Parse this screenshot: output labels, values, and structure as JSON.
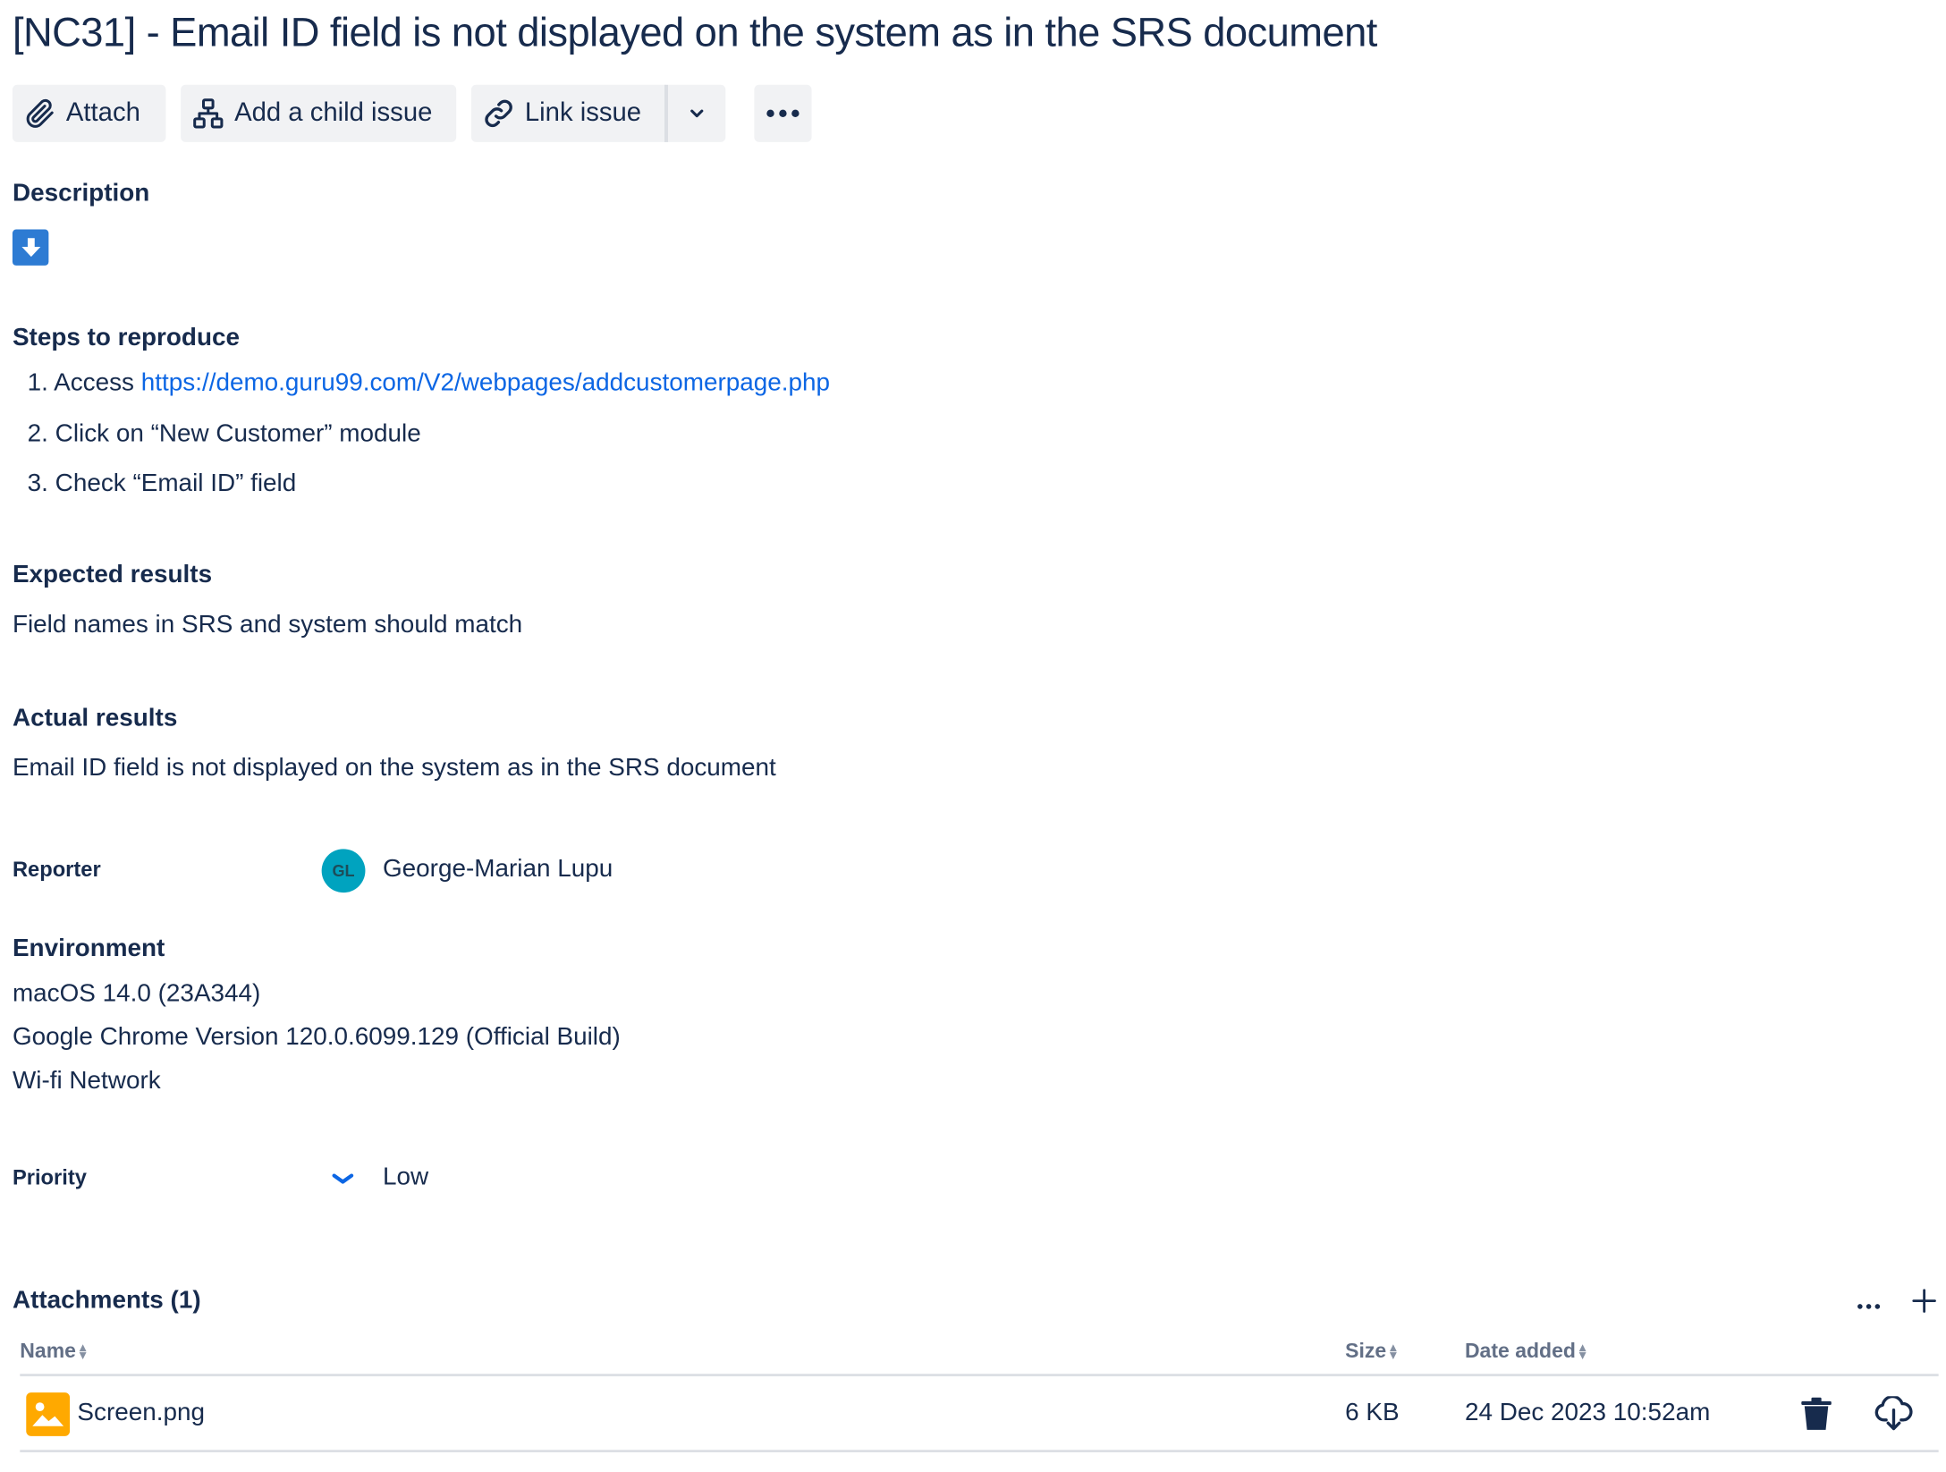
{
  "issue": {
    "title": "[NC31] - Email ID field is not displayed on the system as in the SRS document"
  },
  "toolbar": {
    "attach_label": "Attach",
    "add_child_label": "Add a child issue",
    "link_issue_label": "Link issue"
  },
  "description": {
    "heading": "Description"
  },
  "steps": {
    "heading": "Steps to reproduce",
    "items": [
      {
        "num": "1.",
        "prefix": "Access ",
        "link": "https://demo.guru99.com/V2/webpages/addcustomerpage.php"
      },
      {
        "num": "2.",
        "text": "Click on “New Customer” module"
      },
      {
        "num": "3.",
        "text": "Check “Email ID” field"
      }
    ]
  },
  "expected": {
    "heading": "Expected results",
    "text": "Field names in SRS and system should match"
  },
  "actual": {
    "heading": "Actual results",
    "text": "Email ID field is not displayed on the system as in the SRS document"
  },
  "reporter": {
    "label": "Reporter",
    "initials": "GL",
    "name": "George-Marian Lupu",
    "avatar_color": "#00a3bf"
  },
  "environment": {
    "heading": "Environment",
    "lines": [
      "macOS 14.0 (23A344)",
      "Google Chrome Version 120.0.6099.129 (Official Build)",
      "Wi-fi Network"
    ]
  },
  "priority": {
    "label": "Priority",
    "value": "Low",
    "icon": "chevron-down-icon",
    "color": "#0c66e4"
  },
  "attachments": {
    "heading": "Attachments (1)",
    "columns": {
      "name": "Name",
      "size": "Size",
      "date": "Date added"
    },
    "rows": [
      {
        "name": "Screen.png",
        "size": "6 KB",
        "date": "24 Dec 2023 10:52am",
        "icon": "image-file-icon"
      }
    ]
  },
  "colors": {
    "text": "#172b4d",
    "link": "#0c66e4",
    "button_bg": "#f1f2f4",
    "file_icon": "#ffa900",
    "description_icon": "#2d7bd3"
  }
}
